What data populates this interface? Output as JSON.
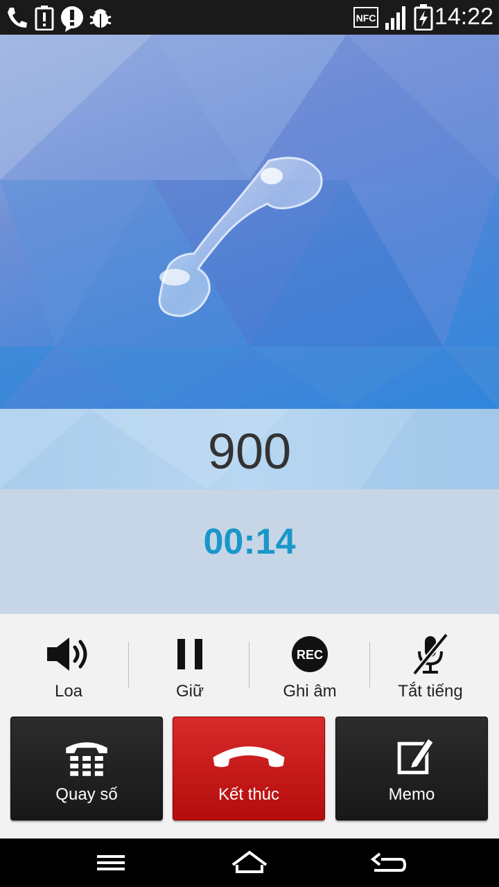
{
  "status_bar": {
    "time": "14:22",
    "left_icons": [
      "phone-call-icon",
      "battery-alert-icon",
      "alert-bubble-icon",
      "debug-bug-icon"
    ],
    "right_icons": [
      "nfc-icon",
      "signal-icon",
      "battery-charging-icon"
    ],
    "nfc_text": "NFC"
  },
  "call": {
    "number": "900",
    "duration": "00:14"
  },
  "controls": {
    "speaker": "Loa",
    "hold": "Giữ",
    "record": "Ghi âm",
    "record_badge": "REC",
    "mute": "Tắt tiếng"
  },
  "buttons": {
    "dialpad": "Quay số",
    "end_call": "Kết thúc",
    "memo": "Memo"
  },
  "colors": {
    "timer": "#1a97c8",
    "end_call": "#c41a1a"
  }
}
